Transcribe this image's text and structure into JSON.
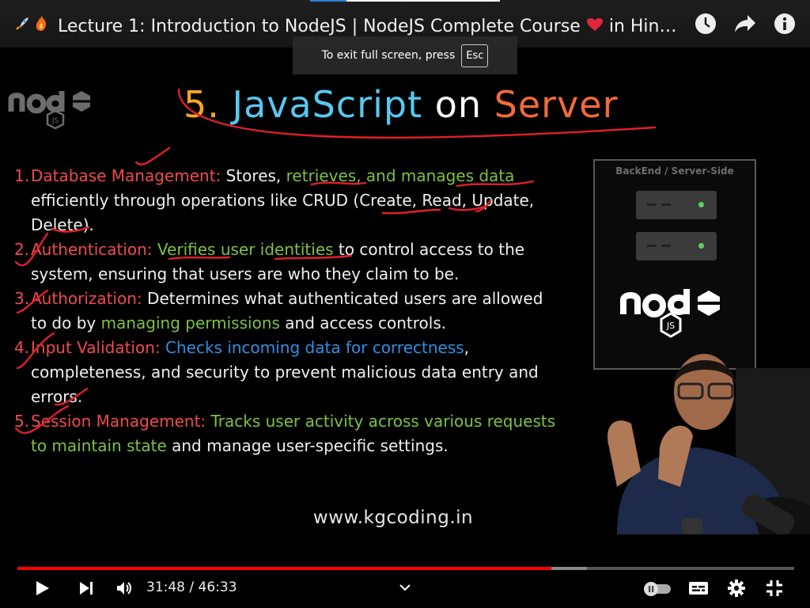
{
  "window": {
    "title": "Lecture 1: Introduction to NodeJS | NodeJS Complete Course",
    "title_suffix": " in Hin…",
    "title_emojis": [
      "rocket-emoji",
      "fire-emoji"
    ],
    "heart_emoji": "heart-emoji"
  },
  "top_actions": [
    "watch-later-icon",
    "share-icon",
    "info-icon"
  ],
  "fullscreen_toast": {
    "text": "To exit full screen, press",
    "key": "Esc"
  },
  "slide": {
    "heading": {
      "num": "5.",
      "js": "JavaScript",
      "on": "on",
      "server": "Server"
    },
    "items": [
      {
        "num": "1.",
        "title": "Database Management:",
        "text1": " Stores, ",
        "highlight": "retrieves, and manages data",
        "text2": " efficiently through operations like CRUD (Create, Read, Update, Delete)."
      },
      {
        "num": "2.",
        "title": "Authentication:",
        "text1": " ",
        "highlight": "Verifies user identities",
        "text2": " to control access to the system, ensuring that users are who they claim to be."
      },
      {
        "num": "3.",
        "title": "Authorization:",
        "text1": " Determines what authenticated users are allowed to do by ",
        "highlight": "managing permissions",
        "text2": " and access controls."
      },
      {
        "num": "4.",
        "title": "Input Validation:",
        "text1": " ",
        "highlight": "Checks incoming data for correctness",
        "text2": ", completeness, and security to prevent malicious data entry and errors."
      },
      {
        "num": "5.",
        "title": "Session Management:",
        "text1": " ",
        "highlight": "Tracks user activity across various requests to maintain state",
        "text2": " and manage user-specific settings."
      }
    ],
    "diagram_label": "BackEnd / Server-Side",
    "website": "www.kgcoding.in"
  },
  "player": {
    "current_time": "31:48",
    "duration": "46:33",
    "time_display": "31:48 / 46:33",
    "played_fraction": 0.687,
    "buffered_fraction": 0.733
  },
  "colors": {
    "accent_red": "#ff0000",
    "slide_red": "#ef4b4b",
    "slide_green": "#7dc243",
    "slide_blue": "#2e8fe3",
    "heading_orange": "#f5a623",
    "heading_cyan": "#58c8f0",
    "heading_server": "#f26a3a"
  }
}
